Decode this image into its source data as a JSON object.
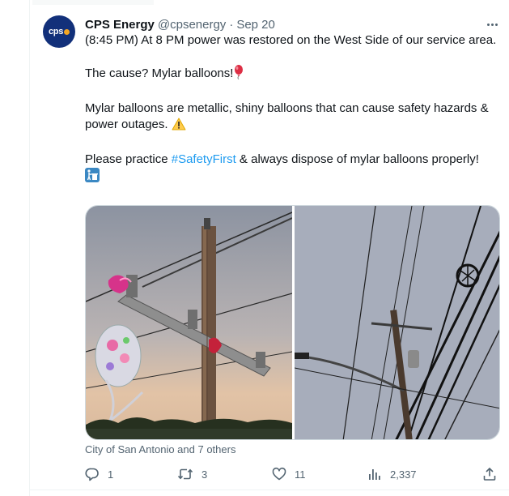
{
  "tweet": {
    "author_name": "CPS Energy",
    "author_handle": "@cpsenergy",
    "separator": "·",
    "date": "Sep 20",
    "avatar_text": "cps",
    "paragraphs": {
      "p1": "(8:45 PM) At 8 PM power was restored on the West Side of our service area.",
      "p2": "The cause? Mylar balloons!",
      "p3": "Mylar balloons are metallic, shiny balloons that can cause safety hazards & power outages.",
      "p4_before": "Please practice ",
      "p4_hashtag": "#SafetyFirst",
      "p4_after": " & always dispose of mylar balloons properly!"
    },
    "emojis": {
      "p2": "balloon-emoji",
      "p3": "warning-emoji",
      "p4": "put-litter-in-its-place-emoji"
    },
    "media_caption": "City of San Antonio and 7 others",
    "actions": {
      "replies": "1",
      "reposts": "3",
      "likes": "11",
      "views": "2,337"
    },
    "colors": {
      "link": "#1d9bf0",
      "muted": "#536471",
      "text": "#0f1419",
      "avatar_bg": "#12307a"
    }
  }
}
